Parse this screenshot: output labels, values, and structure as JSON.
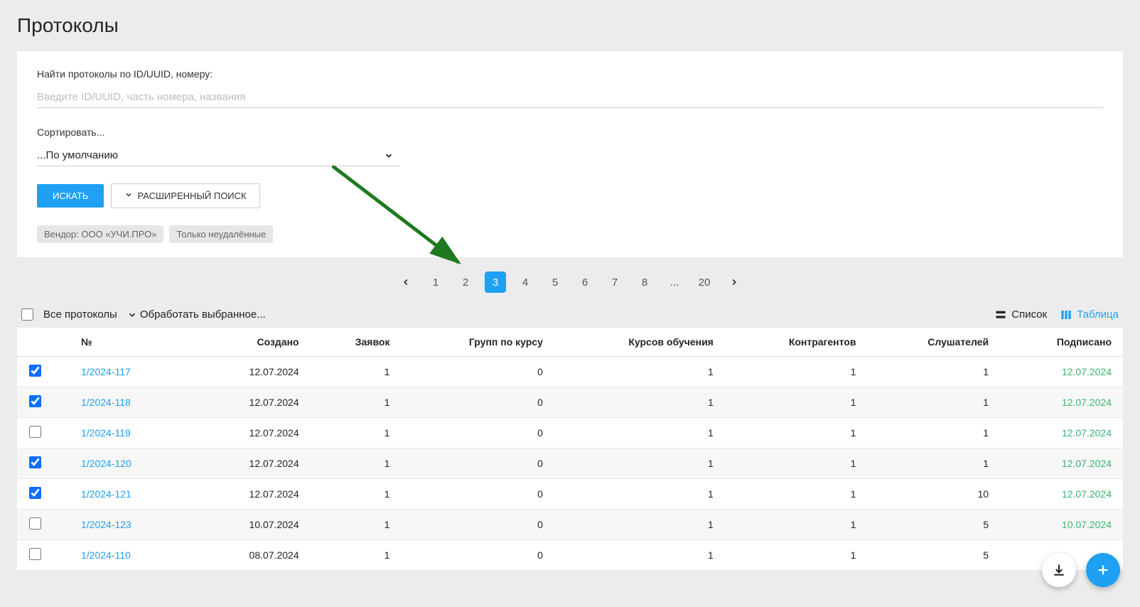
{
  "header": {
    "title": "Протоколы"
  },
  "search": {
    "label": "Найти протоколы по ID/UUID, номеру:",
    "placeholder": "Введите ID/UUID, часть номера, названия"
  },
  "sort": {
    "label": "Сортировать...",
    "selected": "...По умолчанию"
  },
  "buttons": {
    "search": "ИСКАТЬ",
    "advanced": "РАСШИРЕННЫЙ ПОИСК"
  },
  "chips": [
    "Вендор: ООО «УЧИ.ПРО»",
    "Только неудалённые"
  ],
  "pagination": {
    "pages": [
      "1",
      "2",
      "3",
      "4",
      "5",
      "6",
      "7",
      "8",
      "...",
      "20"
    ],
    "active": "3"
  },
  "toolbar": {
    "all_label": "Все протоколы",
    "process_label": "Обработать выбранное...",
    "view_list_label": "Список",
    "view_table_label": "Таблица"
  },
  "table": {
    "columns": [
      "№",
      "Создано",
      "Заявок",
      "Групп по курсу",
      "Курсов обучения",
      "Контрагентов",
      "Слушателей",
      "Подписано"
    ],
    "rows": [
      {
        "checked": true,
        "num": "1/2024-117",
        "created": "12.07.2024",
        "requests": "1",
        "groups": "0",
        "courses": "1",
        "counterparties": "1",
        "listeners": "1",
        "signed": "12.07.2024"
      },
      {
        "checked": true,
        "num": "1/2024-118",
        "created": "12.07.2024",
        "requests": "1",
        "groups": "0",
        "courses": "1",
        "counterparties": "1",
        "listeners": "1",
        "signed": "12.07.2024"
      },
      {
        "checked": false,
        "num": "1/2024-119",
        "created": "12.07.2024",
        "requests": "1",
        "groups": "0",
        "courses": "1",
        "counterparties": "1",
        "listeners": "1",
        "signed": "12.07.2024"
      },
      {
        "checked": true,
        "num": "1/2024-120",
        "created": "12.07.2024",
        "requests": "1",
        "groups": "0",
        "courses": "1",
        "counterparties": "1",
        "listeners": "1",
        "signed": "12.07.2024"
      },
      {
        "checked": true,
        "num": "1/2024-121",
        "created": "12.07.2024",
        "requests": "1",
        "groups": "0",
        "courses": "1",
        "counterparties": "1",
        "listeners": "10",
        "signed": "12.07.2024"
      },
      {
        "checked": false,
        "num": "1/2024-123",
        "created": "10.07.2024",
        "requests": "1",
        "groups": "0",
        "courses": "1",
        "counterparties": "1",
        "listeners": "5",
        "signed": "10.07.2024"
      },
      {
        "checked": false,
        "num": "1/2024-110",
        "created": "08.07.2024",
        "requests": "1",
        "groups": "0",
        "courses": "1",
        "counterparties": "1",
        "listeners": "5",
        "signed": ""
      }
    ]
  }
}
